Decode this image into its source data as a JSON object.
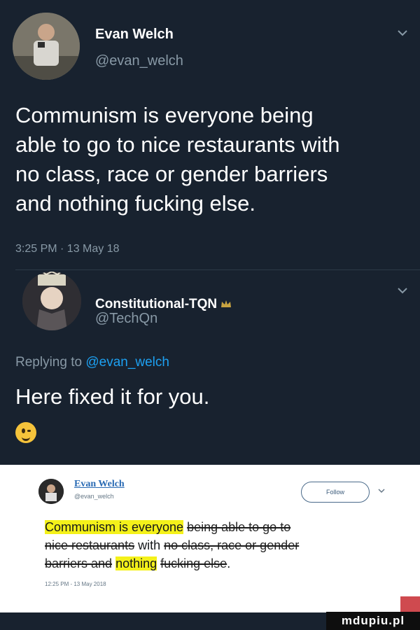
{
  "tweet1": {
    "name": "Evan Welch",
    "handle": "@evan_welch",
    "lines": [
      "Communism is everyone being",
      "able to go to nice restaurants with",
      "no class, race or gender barriers",
      "and nothing fucking else."
    ],
    "timestamp": "3:25 PM · 13 May 18"
  },
  "tweet2": {
    "name": "Constitutional-TQN",
    "handle": "@TechQn",
    "replying_prefix": "Replying to",
    "replying_to": "@evan_welch",
    "text": "Here fixed it for you.",
    "emoji": "winking-face-emoji"
  },
  "card": {
    "name": "Evan Welch",
    "handle": "@evan_welch",
    "follow_label": "Follow",
    "line1_highlight": "Communism is everyone",
    "line1_strike": "being able to go to",
    "line2_strike": "nice restaurants",
    "line2_mid": "with",
    "line2_strike2": "no class, race or gender",
    "line3_strike": "barriers and",
    "line3_highlight": "nothing",
    "line3_strike2": "fucking else",
    "line3_end": ".",
    "timestamp": "12:25 PM - 13 May 2018"
  },
  "watermark": "mdupiu.pl",
  "colors": {
    "background": "#18222f",
    "secondary_text": "#8899a6",
    "link": "#1da1f2",
    "highlight": "#f4f11a"
  }
}
